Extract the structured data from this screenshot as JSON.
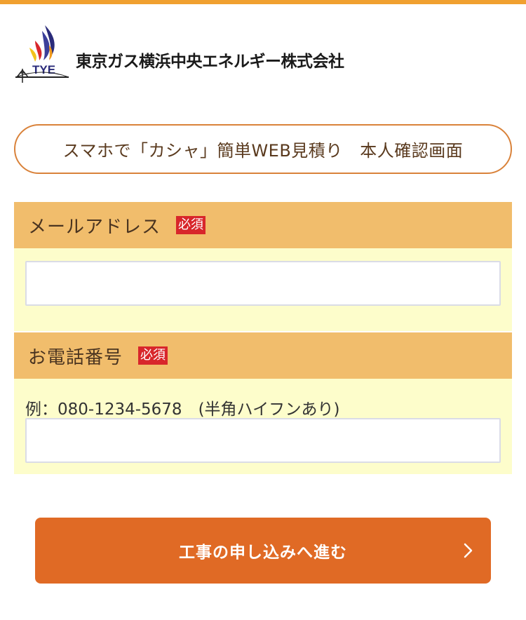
{
  "header": {
    "logo_abbr": "TYE",
    "company_name": "東京ガス横浜中央エネルギー株式会社"
  },
  "page_title": "スマホで「カシャ」簡単WEB見積り　本人確認画面",
  "form": {
    "email": {
      "label": "メールアドレス",
      "required_badge": "必須",
      "value": ""
    },
    "phone": {
      "label": "お電話番号",
      "required_badge": "必須",
      "hint": "例：080-1234-5678　(半角ハイフンあり)",
      "value": ""
    }
  },
  "submit": {
    "label": "工事の申し込みへ進む",
    "icon": "chevron-right-icon"
  },
  "colors": {
    "accent_bar": "#f0a030",
    "section_header": "#f1bd6c",
    "section_body": "#fdfdcb",
    "required_badge": "#d8262b",
    "button": "#e06a25",
    "pill_border": "#d9823a"
  }
}
